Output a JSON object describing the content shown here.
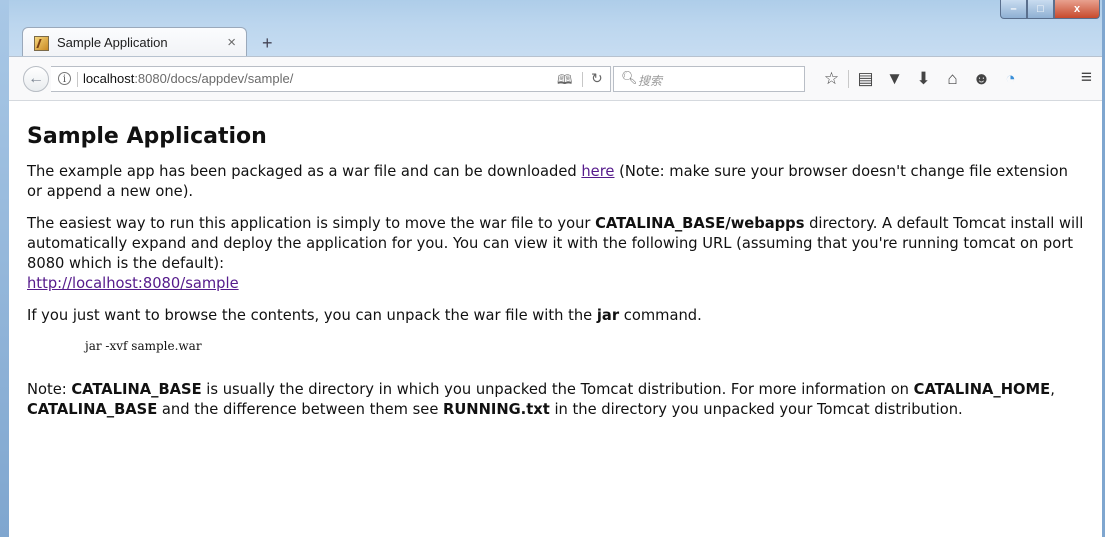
{
  "window": {
    "tab_title": "Sample Application",
    "tab_close": "×",
    "new_tab": "+",
    "minimize": "–",
    "maximize": "□",
    "close": "x"
  },
  "navbar": {
    "url_host": "localhost",
    "url_rest": ":8080/docs/appdev/sample/",
    "search_placeholder": "搜索",
    "icons": [
      "back-icon",
      "info-icon",
      "reader-view-icon",
      "reload-icon",
      "search-icon",
      "bookmark-star-icon",
      "bookmarks-list-icon",
      "pocket-icon",
      "download-icon",
      "home-icon",
      "chat-icon",
      "extension-icon",
      "menu-icon"
    ]
  },
  "page": {
    "heading": "Sample Application",
    "p1_before": "The example app has been packaged as a war file and can be downloaded ",
    "p1_link": "here",
    "p1_after": " (Note: make sure your browser doesn't change file extension or append a new one).",
    "p2_before": "The easiest way to run this application is simply to move the war file to your ",
    "p2_bold": "CATALINA_BASE/webapps",
    "p2_after": " directory. A default Tomcat install will automatically expand and deploy the application for you. You can view it with the following URL (assuming that you're running tomcat on port 8080 which is the default):",
    "p2_link": "http://localhost:8080/sample",
    "p3_before": "If you just want to browse the contents, you can unpack the war file with the ",
    "p3_bold": "jar",
    "p3_after": " command.",
    "code": "jar -xvf sample.war",
    "p4_a": "Note: ",
    "p4_b": "CATALINA_BASE",
    "p4_c": " is usually the directory in which you unpacked the Tomcat distribution. For more information on ",
    "p4_d": "CATALINA_HOME",
    "p4_e": ", ",
    "p4_f": "CATALINA_BASE",
    "p4_g": " and the difference between them see ",
    "p4_h": "RUNNING.txt",
    "p4_i": " in the directory you unpacked your Tomcat distribution."
  }
}
